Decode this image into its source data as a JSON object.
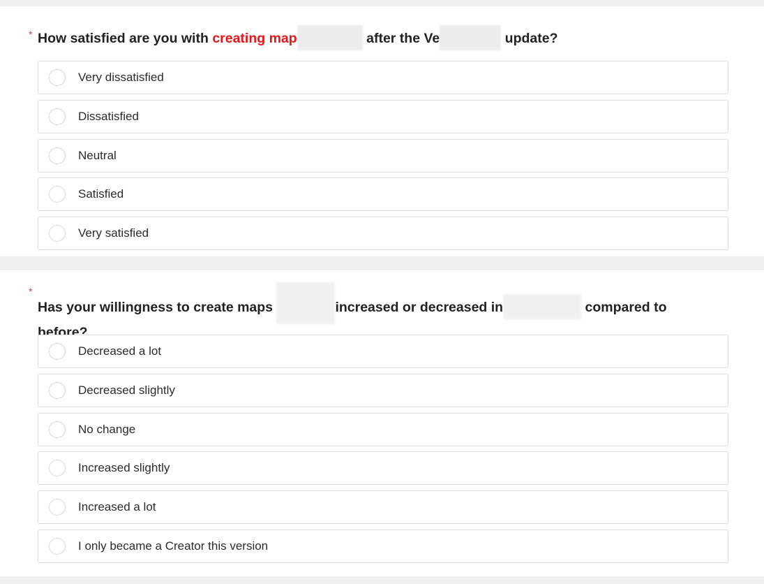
{
  "question1": {
    "required_mark": "*",
    "title_part1": "How satisfied are you with ",
    "title_highlight": "creating map",
    "title_part2": " after the Ve",
    "title_part3": " update?",
    "options": [
      {
        "label": "Very dissatisfied"
      },
      {
        "label": "Dissatisfied"
      },
      {
        "label": "Neutral"
      },
      {
        "label": "Satisfied"
      },
      {
        "label": "Very satisfied"
      }
    ]
  },
  "question2": {
    "required_mark": "*",
    "title_part1": "Has your willingness to create maps ",
    "title_part2": "increased or decreased in",
    "title_part3": " compared to before?",
    "options": [
      {
        "label": "Decreased a lot"
      },
      {
        "label": "Decreased slightly"
      },
      {
        "label": "No change"
      },
      {
        "label": "Increased slightly"
      },
      {
        "label": "Increased a lot"
      },
      {
        "label": "I only became a Creator this version"
      }
    ]
  },
  "colors": {
    "required": "#e5413b",
    "highlight": "#e8141a",
    "page_background": "#efefef",
    "card_background": "#ffffff"
  }
}
